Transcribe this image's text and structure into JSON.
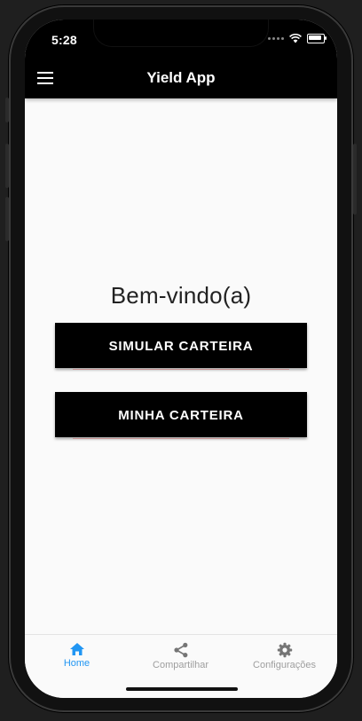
{
  "status_bar": {
    "time": "5:28"
  },
  "app_bar": {
    "title": "Yield App",
    "menu_icon": "hamburger-menu-icon"
  },
  "main": {
    "welcome_text": "Bem-vindo(a)",
    "buttons": [
      {
        "label": "SIMULAR CARTEIRA"
      },
      {
        "label": "MINHA CARTEIRA"
      }
    ]
  },
  "bottom_nav": {
    "items": [
      {
        "label": "Home",
        "icon": "home-icon",
        "active": true
      },
      {
        "label": "Compartilhar",
        "icon": "share-icon",
        "active": false
      },
      {
        "label": "Configurações",
        "icon": "gear-icon",
        "active": false
      }
    ]
  },
  "colors": {
    "accent": "#2196f3",
    "inactive": "#9e9e9e",
    "bar_background": "#000000",
    "screen_background": "#fafafa"
  }
}
